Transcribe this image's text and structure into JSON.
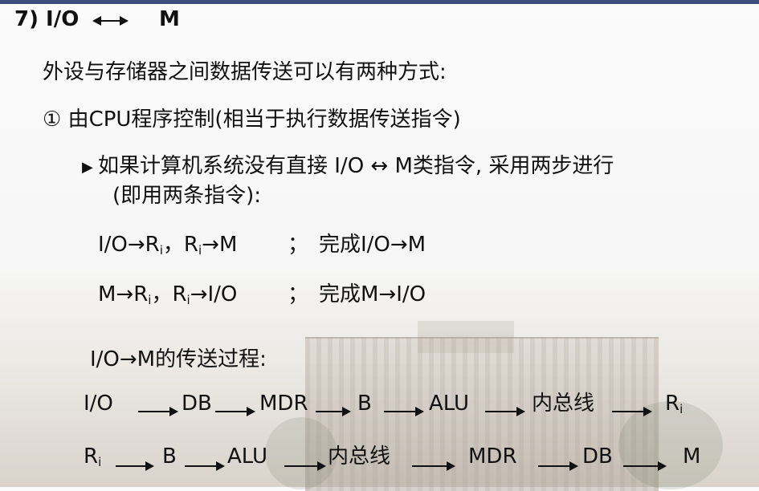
{
  "title": {
    "text": "7) I/O",
    "target": "M"
  },
  "intro": "外设与存储器之间数据传送可以有两种方式:",
  "method1": "① 由CPU程序控制(相当于执行数据传送指令)",
  "bullet": {
    "marker": "▶",
    "line1": "如果计算机系统没有直接 I/O ↔ M类指令, 采用两步进行",
    "line2": "(即用两条指令):"
  },
  "row1": {
    "a": "I/O→R",
    "sub1": "i",
    "mid": "，R",
    "sub2": "i",
    "b": "→M",
    "semicolon": "；",
    "comment": "完成I/O→M"
  },
  "row2": {
    "a": "M→R",
    "sub1": "i",
    "mid": "，R",
    "sub2": "i",
    "b": "→I/O",
    "semicolon": "；",
    "comment": "完成M→I/O"
  },
  "process_title": "I/O→M的传送过程:",
  "flow1": {
    "n0": "I/O",
    "n1": "DB",
    "n2": "MDR",
    "n3": "B",
    "n4": "ALU",
    "n5": "内总线",
    "n6": "R",
    "n6_sub": "i"
  },
  "flow2": {
    "n0": "R",
    "n0_sub": "i",
    "n1": "B",
    "n2": "ALU",
    "n3": "内总线",
    "n4": "MDR",
    "n5": "DB",
    "n6": "M"
  }
}
